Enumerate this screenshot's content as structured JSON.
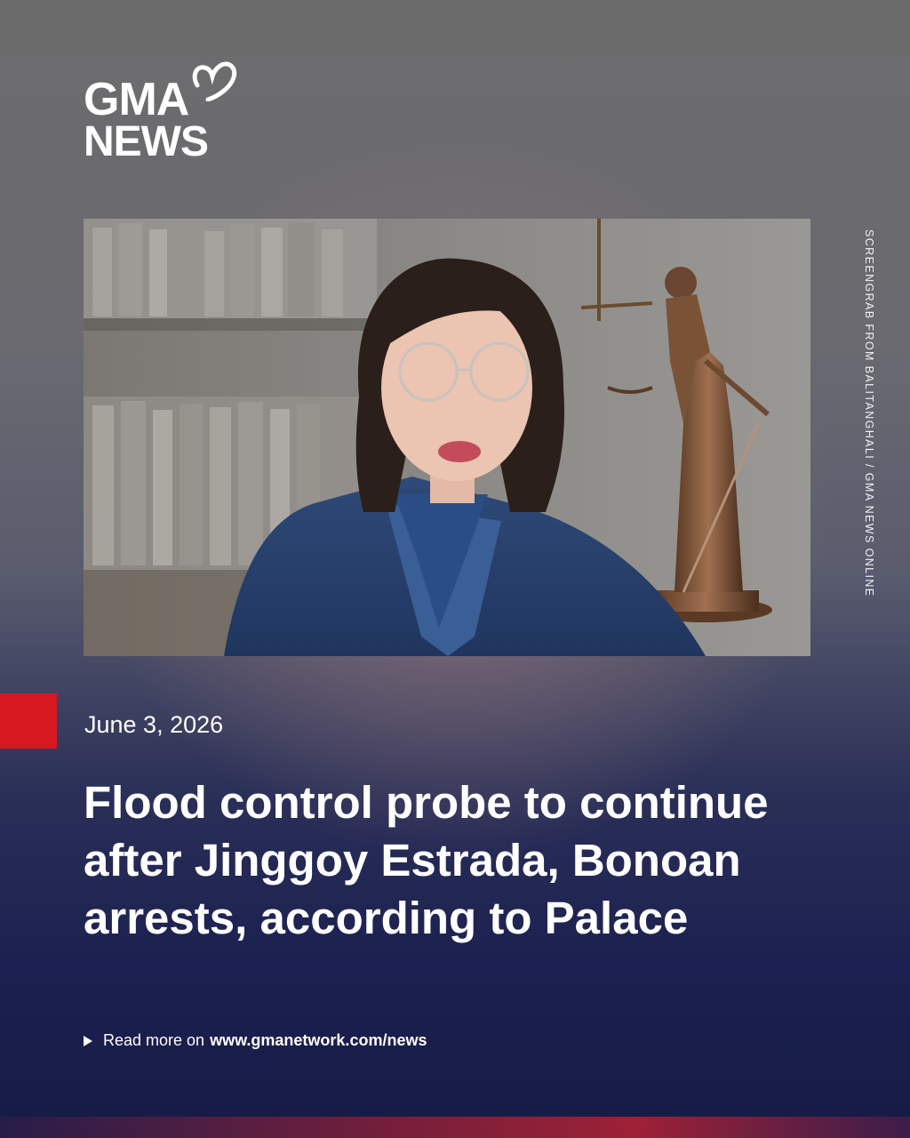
{
  "brand": {
    "line1": "GMA",
    "line2": "NEWS"
  },
  "photo": {
    "credit": "SCREENGRAB FROM BALITANGHALI / GMA NEWS ONLINE"
  },
  "article": {
    "date": "June 3, 2026",
    "headline": "Flood control probe to continue after Jinggoy Estrada, Bonoan arrests, according to Palace"
  },
  "footer": {
    "prefix": "Read more on",
    "url": "www.gmanetwork.com/news"
  },
  "colors": {
    "accent_red": "#d71920",
    "navy": "#1b2050"
  },
  "icons": {
    "play": "play-icon",
    "heart": "heart-icon"
  }
}
